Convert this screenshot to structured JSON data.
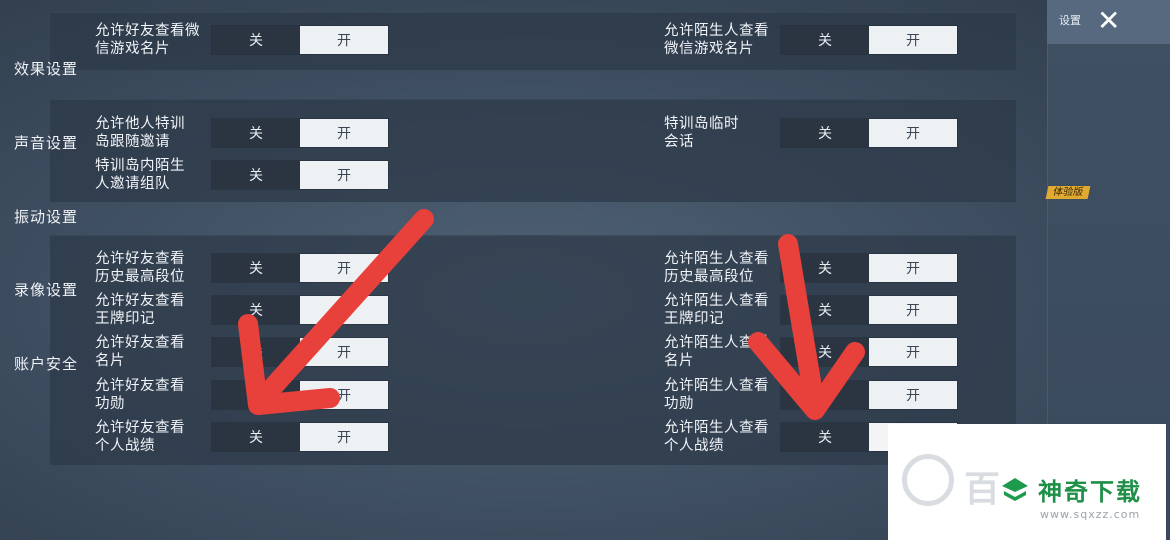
{
  "topbar": {
    "label": "设置",
    "close": "✕"
  },
  "sidebar": {
    "items": [
      {
        "label": "效果设置"
      },
      {
        "label": "声音设置"
      },
      {
        "label": "振动设置",
        "badge": "体验版"
      },
      {
        "label": "录像设置"
      },
      {
        "label": "账户安全"
      }
    ]
  },
  "toggle": {
    "off": "关",
    "on": "开"
  },
  "group1": {
    "left": {
      "label": "允许好友查看微\n信游戏名片"
    },
    "right": {
      "label": "允许陌生人查看\n微信游戏名片"
    }
  },
  "group2": {
    "left1": {
      "label": "允许他人特训\n岛跟随邀请"
    },
    "left2": {
      "label": "特训岛内陌生\n人邀请组队"
    },
    "right1": {
      "label": "特训岛临时\n会话"
    }
  },
  "group3": {
    "left": [
      {
        "label": "允许好友查看\n历史最高段位"
      },
      {
        "label": "允许好友查看\n王牌印记"
      },
      {
        "label": "允许好友查看\n名片"
      },
      {
        "label": "允许好友查看\n功勋"
      },
      {
        "label": "允许好友查看\n个人战绩"
      }
    ],
    "right": [
      {
        "label": "允许陌生人查看\n历史最高段位"
      },
      {
        "label": "允许陌生人查看\n王牌印记"
      },
      {
        "label": "允许陌生人查看\n名片"
      },
      {
        "label": "允许陌生人查看\n功勋"
      },
      {
        "label": "允许陌生人查看\n个人战绩"
      }
    ]
  },
  "watermark": {
    "brand": "神奇下载",
    "url": "www.sqxzz.com",
    "partial": "百"
  },
  "colors": {
    "arrow": "#e8413c",
    "badge": "#e0a932",
    "panel": "#2c3948"
  }
}
